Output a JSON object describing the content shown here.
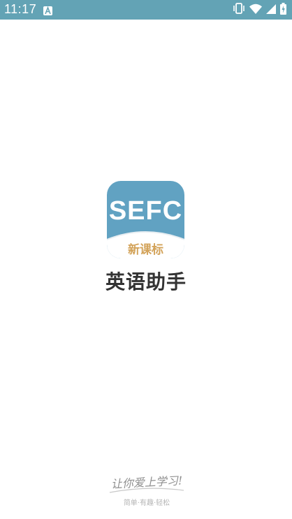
{
  "status_bar": {
    "time": "11:17",
    "background_color": "#63a3b5",
    "notification_icon": "text-a-icon",
    "system_icons": [
      "vibrate-icon",
      "wifi-icon",
      "cell-signal-icon",
      "battery-charging-icon"
    ]
  },
  "splash": {
    "logo_text": "SEFC",
    "logo_subtitle": "新课标",
    "app_name": "英语助手",
    "logo_color": "#61a2c2",
    "subtitle_color": "#d3a35a"
  },
  "footer": {
    "slogan": "让你爱上学习!",
    "tagline": "简单·有趣·轻松"
  }
}
